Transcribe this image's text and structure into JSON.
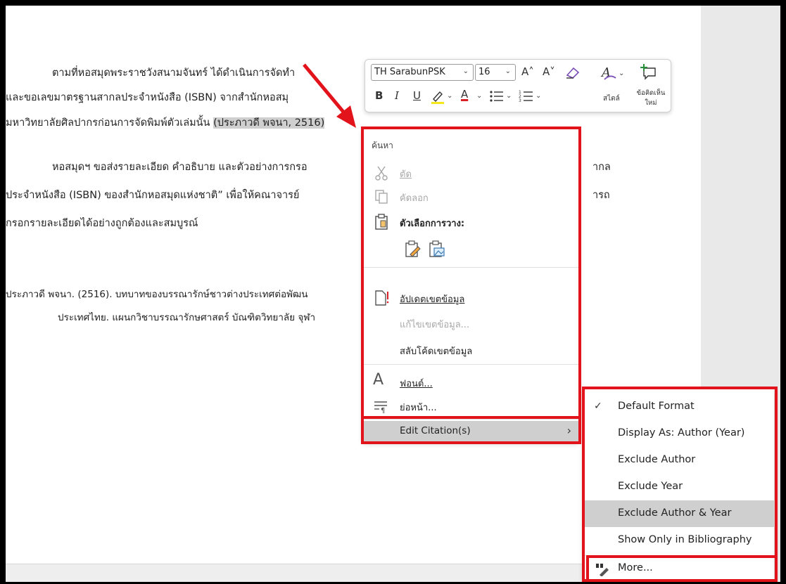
{
  "document": {
    "line1": "ตามที่หอสมุดพระราชวังสนามจันทร์ ได้ดำเนินการจัดทำ",
    "line2": "และขอเลขมาตรฐานสากลประจำหนังสือ (ISBN) จากสำนักหอสมุ",
    "line3_pre": "มหาวิทยาลัยศิลปากรก่อนการจัดพิมพ์ตัวเล่มนั้น ",
    "line3_selected": "(ประภาวดี พจนา, 2516)",
    "line4": "หอสมุดฯ ขอส่งรายละเอียด คำอธิบาย และตัวอย่างการกรอ",
    "line4_tail": "ากล",
    "line5": "ประจำหนังสือ (ISBN) ของสำนักหอสมุดแห่งชาติ” เพื่อให้คณาจารย์",
    "line5_tail": "ารถ",
    "line6": "กรอกรายละเอียดได้อย่างถูกต้องและสมบูรณ์",
    "ref1": "ประภาวดี พจนา. (2516). บทบาทของบรรณารักษ์ชาวต่างประเทศต่อพัฒน",
    "ref2": "ประเทศไทย. แผนกวิชาบรรณารักษศาสตร์ บัณฑิตวิทยาลัย จุฬา"
  },
  "mini_toolbar": {
    "font_name": "TH SarabunPSK",
    "font_size": "16",
    "grow_font": "A˄",
    "shrink_font": "A˅",
    "bold": "B",
    "italic": "I",
    "underline": "U",
    "font_color_letter": "A",
    "styles_label": "สไตล์",
    "comment_label_1": "ข้อคิดเห็น",
    "comment_label_2": "ใหม่"
  },
  "context_menu": {
    "search_placeholder": "ค้นหา",
    "items": [
      {
        "label": "ตัด",
        "disabled": true
      },
      {
        "label": "คัดลอก",
        "disabled": true
      },
      {
        "label": "ตัวเลือกการวาง:",
        "disabled": false
      },
      {
        "label": "อัปเดตเขตข้อมูล",
        "disabled": false
      },
      {
        "label": "แก้ไขเขตข้อมูล...",
        "disabled": true
      },
      {
        "label": "สลับโค้ดเขตข้อมูล",
        "disabled": false
      },
      {
        "label": "ฟอนต์...",
        "disabled": false
      },
      {
        "label": "ย่อหน้า...",
        "disabled": false
      }
    ],
    "edit_citation": "Edit Citation(s)",
    "edit_citation_arrow": "›"
  },
  "citation_submenu": {
    "check_mark": "✓",
    "items": [
      {
        "label": "Default Format",
        "checked": true
      },
      {
        "label": "Display As: Author (Year)",
        "checked": false
      },
      {
        "label": "Exclude Author",
        "checked": false
      },
      {
        "label": "Exclude Year",
        "checked": false
      },
      {
        "label": "Exclude Author & Year",
        "checked": false
      },
      {
        "label": "Show Only in Bibliography",
        "checked": false
      }
    ],
    "more": "More..."
  },
  "colors": {
    "annotation_red": "#e3131b",
    "highlight_gray": "#cfcfcf",
    "font_color_red": "#d92027",
    "highlighter_yellow": "#f6e71c"
  }
}
